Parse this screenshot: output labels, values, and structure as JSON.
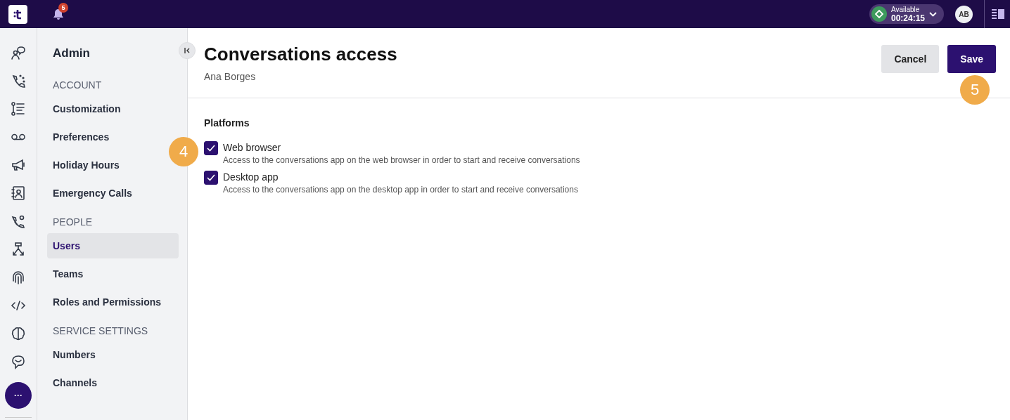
{
  "topbar": {
    "notification_count": "5",
    "status": {
      "label": "Available",
      "timer": "00:24:15"
    },
    "avatar": "AB"
  },
  "rail": {
    "more": "···"
  },
  "sidebar": {
    "title": "Admin",
    "sections": [
      {
        "heading": "ACCOUNT",
        "items": [
          {
            "label": "Customization",
            "selected": false
          },
          {
            "label": "Preferences",
            "selected": false
          },
          {
            "label": "Holiday Hours",
            "selected": false
          },
          {
            "label": "Emergency Calls",
            "selected": false
          }
        ]
      },
      {
        "heading": "PEOPLE",
        "items": [
          {
            "label": "Users",
            "selected": true
          },
          {
            "label": "Teams",
            "selected": false
          },
          {
            "label": "Roles and Permissions",
            "selected": false
          }
        ]
      },
      {
        "heading": "SERVICE SETTINGS",
        "items": [
          {
            "label": "Numbers",
            "selected": false
          },
          {
            "label": "Channels",
            "selected": false
          }
        ]
      }
    ]
  },
  "header": {
    "title": "Conversations access",
    "subtitle": "Ana Borges",
    "buttons": [
      {
        "label": "Cancel",
        "kind": "secondary"
      },
      {
        "label": "Save",
        "kind": "primary"
      }
    ]
  },
  "platforms": {
    "heading": "Platforms",
    "options": [
      {
        "label": "Web browser",
        "description": "Access to the conversations app on the web browser in order to start and receive conversations",
        "checked": true
      },
      {
        "label": "Desktop app",
        "description": "Access to the conversations app on the desktop app in order to start and receive conversations",
        "checked": true
      }
    ]
  },
  "callouts": [
    "4",
    "5"
  ]
}
